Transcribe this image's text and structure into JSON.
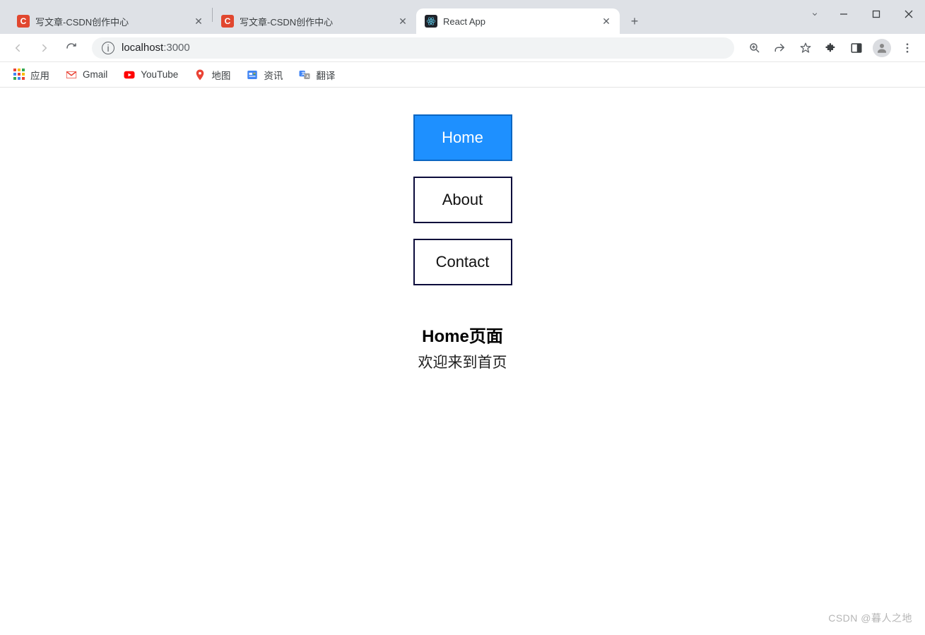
{
  "window": {
    "tabs": [
      {
        "title": "写文章-CSDN创作中心",
        "favicon": "csdn",
        "active": false
      },
      {
        "title": "写文章-CSDN创作中心",
        "favicon": "csdn",
        "active": false
      },
      {
        "title": "React App",
        "favicon": "react",
        "active": true
      }
    ]
  },
  "address": {
    "host": "localhost",
    "port": ":3000"
  },
  "bookmarks": [
    {
      "label": "应用",
      "icon": "apps"
    },
    {
      "label": "Gmail",
      "icon": "gmail"
    },
    {
      "label": "YouTube",
      "icon": "youtube"
    },
    {
      "label": "地图",
      "icon": "maps"
    },
    {
      "label": "资讯",
      "icon": "news"
    },
    {
      "label": "翻译",
      "icon": "translate"
    }
  ],
  "page": {
    "nav": [
      {
        "label": "Home",
        "active": true
      },
      {
        "label": "About",
        "active": false
      },
      {
        "label": "Contact",
        "active": false
      }
    ],
    "heading": "Home页面",
    "subtitle": "欢迎来到首页"
  },
  "watermark": "CSDN @暮人之地"
}
